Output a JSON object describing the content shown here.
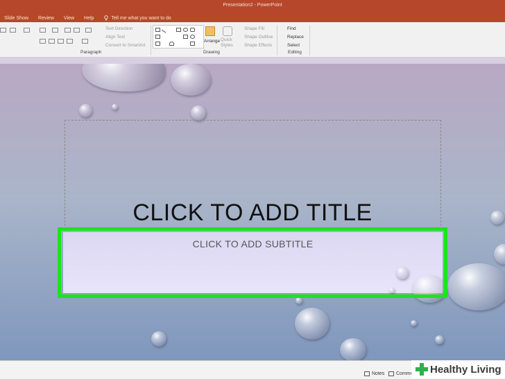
{
  "window": {
    "title": "Presentation2 - PowerPoint"
  },
  "tabs": [
    "Slide Show",
    "Review",
    "View",
    "Help"
  ],
  "tell_me": "Tell me what you want to do",
  "ribbon": {
    "paragraph": {
      "label": "Paragraph",
      "text_direction": "Text Direction",
      "align_text": "Align Text",
      "convert_smartart": "Convert to SmartArt"
    },
    "drawing": {
      "label": "Drawing",
      "arrange": "Arrange",
      "quick_styles": "Quick Styles",
      "shape_fill": "Shape Fill",
      "shape_outline": "Shape Outline",
      "shape_effects": "Shape Effects"
    },
    "editing": {
      "label": "Editing",
      "find": "Find",
      "replace": "Replace",
      "select": "Select"
    }
  },
  "slide": {
    "title_placeholder": "CLICK TO ADD TITLE",
    "subtitle_placeholder": "CLICK TO ADD SUBTITLE"
  },
  "statusbar": {
    "notes": "Notes",
    "comments": "Comment"
  },
  "watermark": {
    "brand": "Healthy Living"
  },
  "colors": {
    "ribbon_accent": "#b7472a",
    "highlight": "#19e619",
    "watermark_green": "#2db14a"
  }
}
